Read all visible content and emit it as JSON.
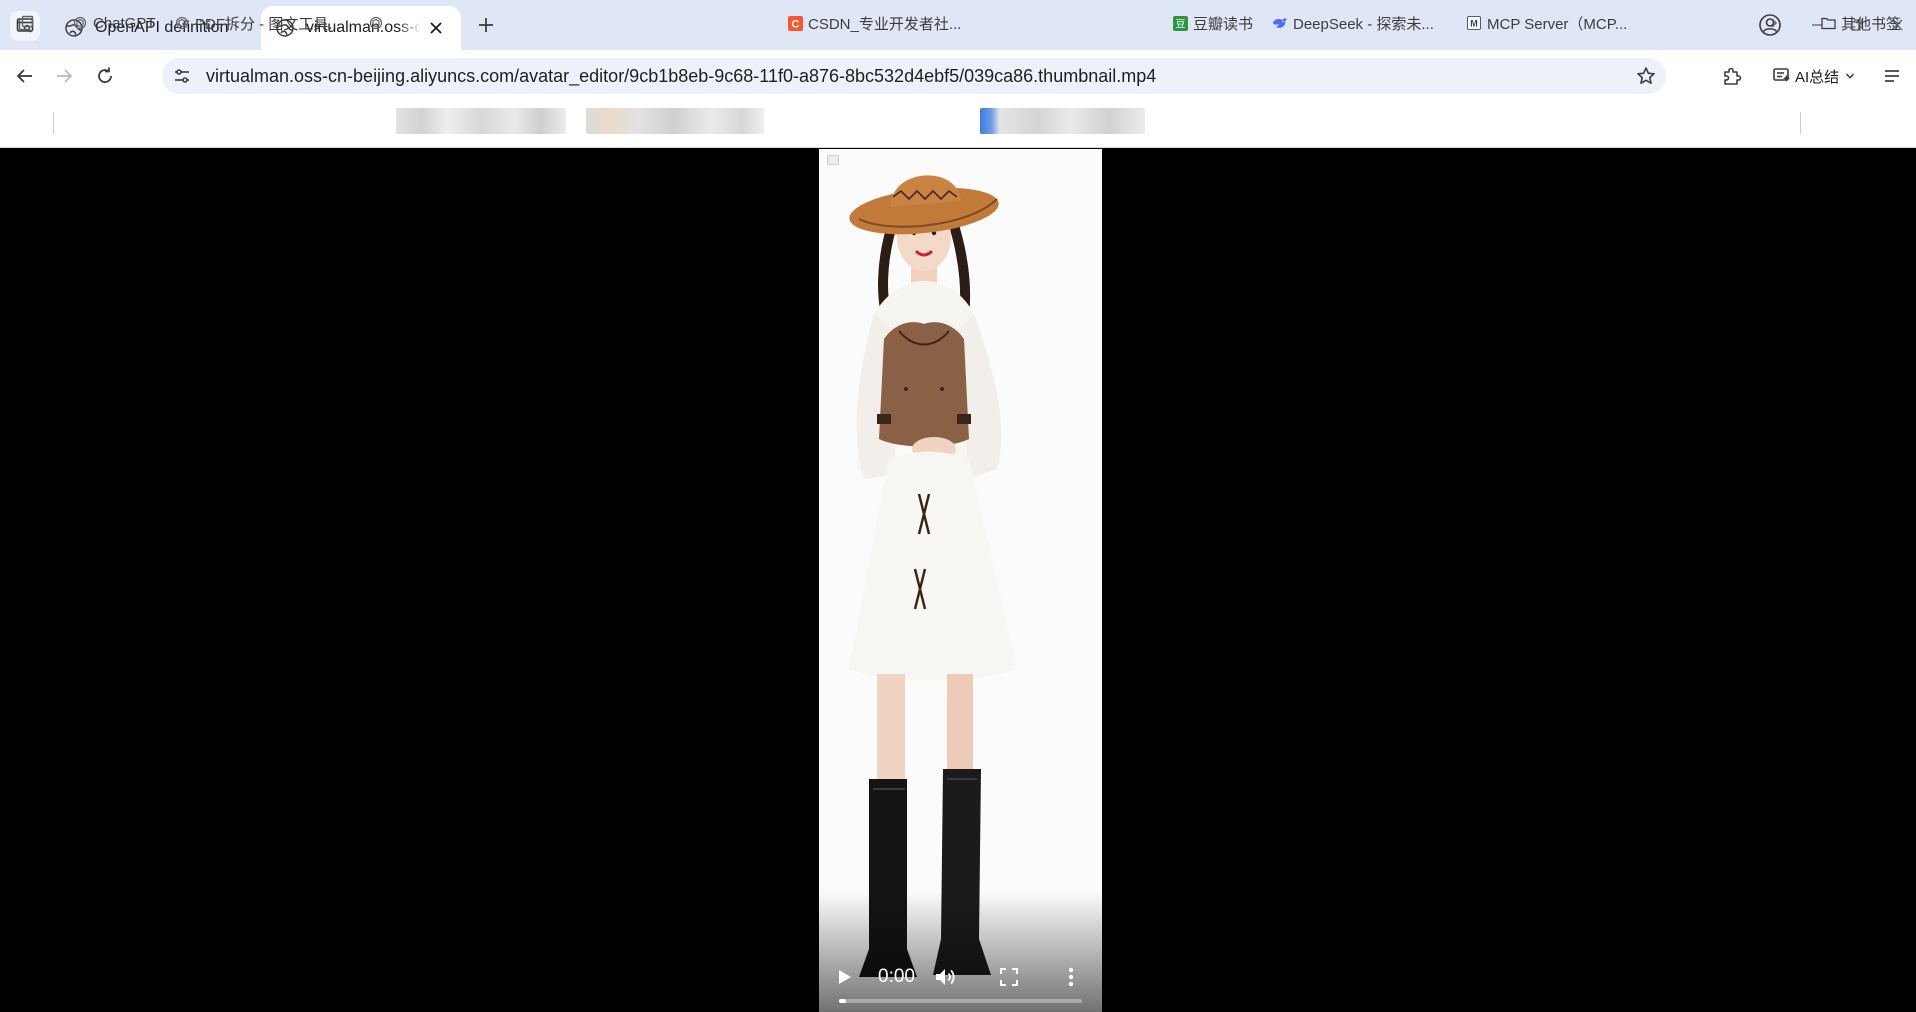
{
  "tabs": [
    {
      "title": "OpenAPI definition",
      "active": false
    },
    {
      "title": "virtualman.oss-cn-beijing.aliyuncs.com",
      "active": true
    }
  ],
  "address_bar": {
    "url": "virtualman.oss-cn-beijing.aliyuncs.com/avatar_editor/9cb1b8eb-9c68-11f0-a876-8bc532d4ebf5/039ca86.thumbnail.mp4"
  },
  "toolbar": {
    "ai_summary_label": "AI总结"
  },
  "bookmarks": [
    {
      "label": "ChatGPT",
      "icon": "chatgpt-icon"
    },
    {
      "label": "PDF拆分 - 图文工具...",
      "icon": "chatgpt-icon"
    },
    {
      "label": "CSDN_专业开发者社...",
      "icon": "csdn-icon"
    },
    {
      "label": "豆瓣读书",
      "icon": "douban-icon"
    },
    {
      "label": "DeepSeek - 探索未...",
      "icon": "deepseek-icon"
    },
    {
      "label": "MCP Server（MCP...",
      "icon": "mcp-icon"
    }
  ],
  "other_bookmarks_label": "其他书签",
  "video": {
    "current_time": "0:00",
    "progress": 0.03
  },
  "colors": {
    "tabstrip_bg": "#dfe6f6",
    "omnibox_bg": "#edf1fa",
    "csdn_red": "#fc5531",
    "douban_green": "#2e963d",
    "deepseek_blue": "#4d6bfe"
  }
}
